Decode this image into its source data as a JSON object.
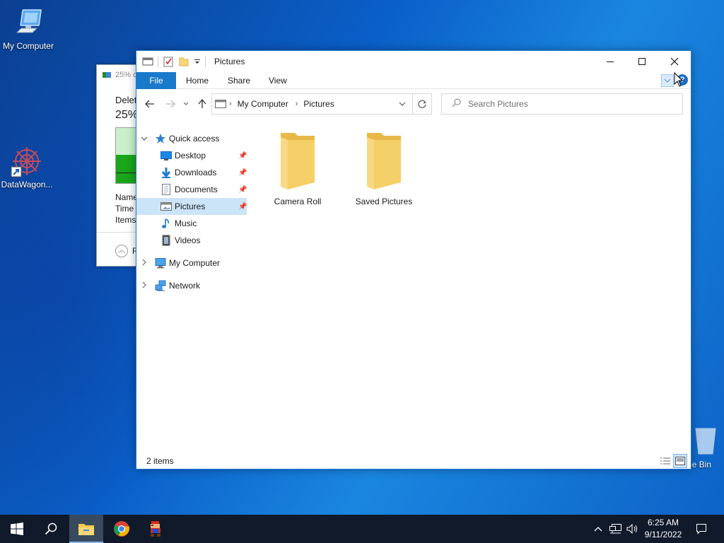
{
  "desktop": {
    "icons": [
      {
        "label": "My Computer"
      },
      {
        "label": "DataWagon..."
      },
      {
        "label": "e Bin"
      }
    ]
  },
  "progress_dialog": {
    "title": "25% c",
    "operation": "Deleti",
    "percent": "25%",
    "progress_fraction": 0.25,
    "rows": [
      "Name",
      "Time",
      "Items"
    ],
    "more_details": "F"
  },
  "explorer": {
    "title": "Pictures",
    "ribbon_tabs": [
      "File",
      "Home",
      "Share",
      "View"
    ],
    "help_label": "?",
    "address": {
      "segments": [
        "My Computer",
        "Pictures"
      ]
    },
    "search": {
      "placeholder": "Search Pictures"
    },
    "nav": {
      "quick_access": "Quick access",
      "quick_items": [
        {
          "label": "Desktop",
          "icon": "desktop-icon",
          "pinned": true
        },
        {
          "label": "Downloads",
          "icon": "downloads-icon",
          "pinned": true
        },
        {
          "label": "Documents",
          "icon": "documents-icon",
          "pinned": true
        },
        {
          "label": "Pictures",
          "icon": "pictures-icon",
          "pinned": true,
          "selected": true
        },
        {
          "label": "Music",
          "icon": "music-icon",
          "pinned": false
        },
        {
          "label": "Videos",
          "icon": "videos-icon",
          "pinned": false
        }
      ],
      "my_computer": "My Computer",
      "network": "Network"
    },
    "folders": [
      {
        "name": "Camera Roll"
      },
      {
        "name": "Saved Pictures"
      }
    ],
    "status": "2 items"
  },
  "taskbar": {
    "time": "6:25 AM",
    "date": "9/11/2022",
    "pinned": [
      "start-button",
      "search-button",
      "file-explorer-button",
      "chrome-button",
      "game-app-button"
    ]
  },
  "colors": {
    "accent": "#1979ca",
    "selected": "#cce4f7",
    "taskbar": "#101a2a",
    "folder": "#f5cf67"
  }
}
